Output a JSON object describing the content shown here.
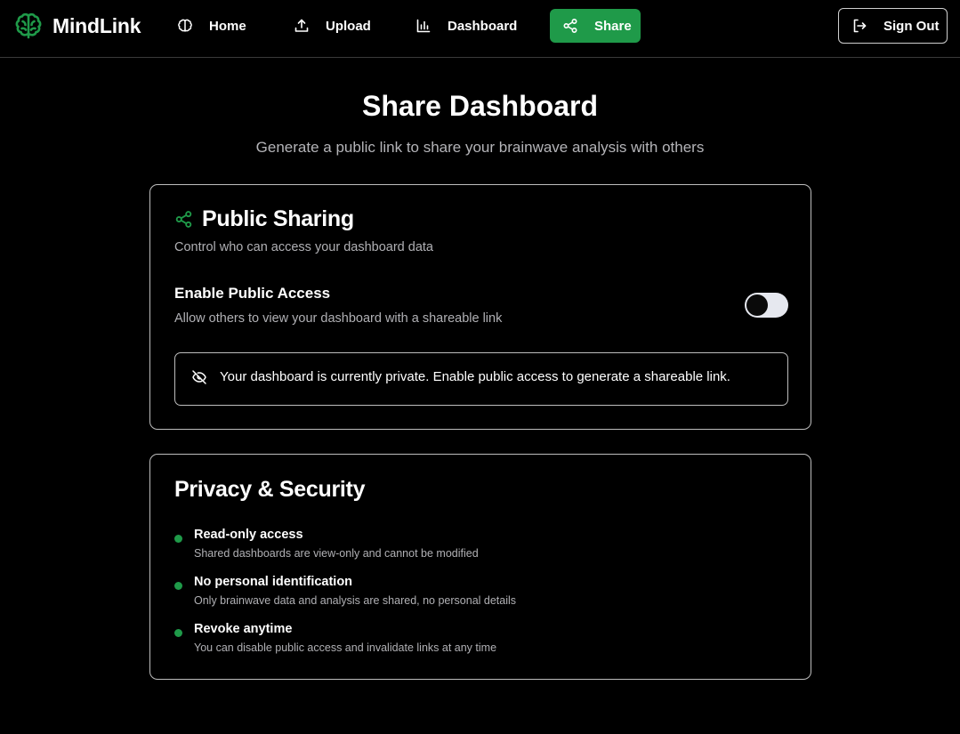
{
  "app": {
    "name": "MindLink",
    "logo_icon": "brain-icon",
    "accent_color": "#1f9a49"
  },
  "nav": {
    "items": [
      {
        "label": "Home",
        "icon": "brain-outline-icon"
      },
      {
        "label": "Upload",
        "icon": "upload-icon"
      },
      {
        "label": "Dashboard",
        "icon": "bar-chart-icon"
      },
      {
        "label": "Share",
        "icon": "share-icon",
        "active": true
      }
    ],
    "sign_out": {
      "label": "Sign Out",
      "icon": "logout-icon"
    }
  },
  "page": {
    "title": "Share Dashboard",
    "subtitle": "Generate a public link to share your brainwave analysis with others"
  },
  "public_sharing": {
    "title": "Public Sharing",
    "icon": "share-icon",
    "description": "Control who can access your dashboard data",
    "access_title": "Enable Public Access",
    "access_description": "Allow others to view your dashboard with a shareable link",
    "toggle_enabled": false,
    "notice_icon": "eye-off-icon",
    "notice": "Your dashboard is currently private. Enable public access to generate a shareable link."
  },
  "privacy": {
    "title": "Privacy & Security",
    "features": [
      {
        "title": "Read-only access",
        "description": "Shared dashboards are view-only and cannot be modified"
      },
      {
        "title": "No personal identification",
        "description": "Only brainwave data and analysis are shared, no personal details"
      },
      {
        "title": "Revoke anytime",
        "description": "You can disable public access and invalidate links at any time"
      }
    ]
  }
}
